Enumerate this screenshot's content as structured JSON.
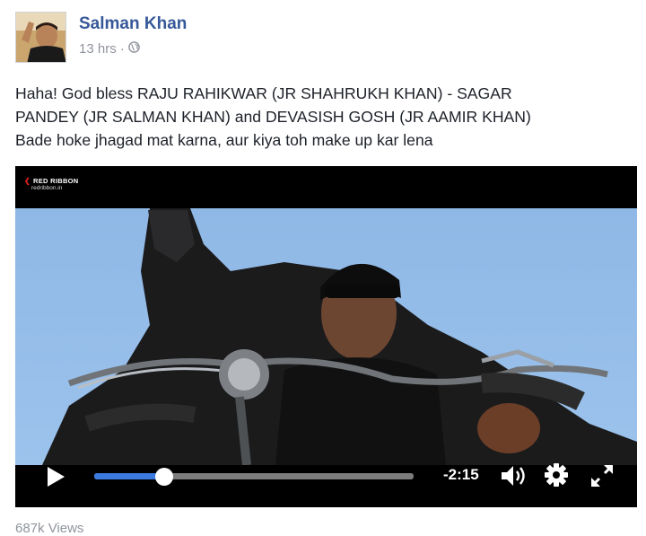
{
  "post": {
    "author": "Salman Khan",
    "time": "13 hrs",
    "separator": "·",
    "privacy_icon": "globe-icon",
    "text_lines": [
      "Haha! God bless RAJU RAHIKWAR (JR SHAHRUKH KHAN) - SAGAR",
      "PANDEY (JR SALMAN KHAN) and DEVASISH GOSH (JR AAMIR KHAN)",
      "Bade hoke jhagad mat karna, aur kiya toh make up kar lena"
    ]
  },
  "video": {
    "watermark_name": "RED RIBBON",
    "watermark_url": "redribbon.in",
    "progress_fraction": 0.22,
    "time_remaining": "-2:15",
    "icons": [
      "play-icon",
      "volume-icon",
      "gear-icon",
      "fullscreen-icon"
    ],
    "accent_color": "#3b7be0"
  },
  "footer": {
    "views": "687k Views"
  }
}
